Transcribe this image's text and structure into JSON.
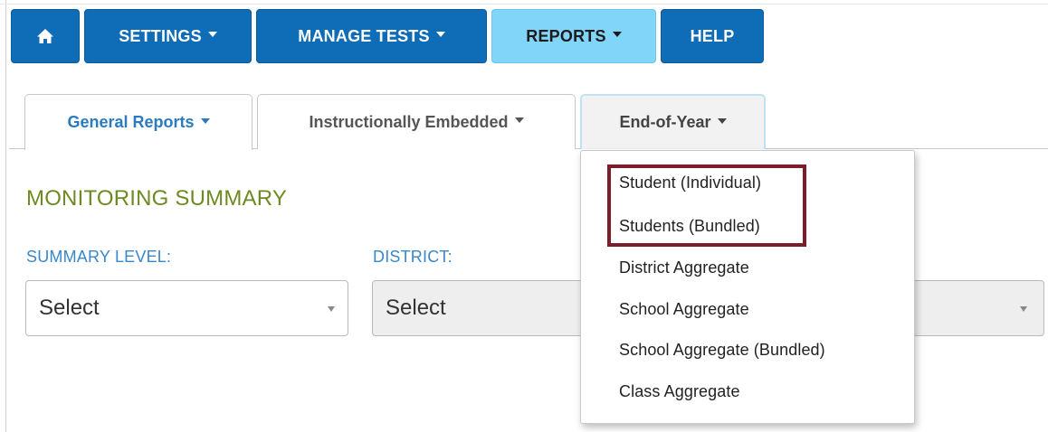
{
  "topnav": {
    "items": [
      {
        "id": "home",
        "label": "",
        "icon": "home-icon"
      },
      {
        "id": "settings",
        "label": "SETTINGS"
      },
      {
        "id": "manage_tests",
        "label": "MANAGE TESTS"
      },
      {
        "id": "reports",
        "label": "REPORTS",
        "active": true
      },
      {
        "id": "help",
        "label": "HELP"
      }
    ]
  },
  "tabs": [
    {
      "label": "General Reports",
      "active": true
    },
    {
      "label": "Instructionally Embedded"
    },
    {
      "label": "End-of-Year",
      "open": true
    }
  ],
  "main": {
    "title": "MONITORING SUMMARY",
    "summary_level": {
      "label": "SUMMARY LEVEL:",
      "value": "Select"
    },
    "district": {
      "label": "DISTRICT:",
      "value": "Select"
    }
  },
  "dropdown": {
    "items": [
      {
        "label": "Student (Individual)",
        "highlighted": true
      },
      {
        "label": "Students (Bundled)",
        "highlighted": true
      },
      {
        "label": "District Aggregate"
      },
      {
        "label": "School Aggregate"
      },
      {
        "label": "School Aggregate (Bundled)"
      },
      {
        "label": "Class Aggregate"
      }
    ]
  },
  "colors": {
    "nav_blue": "#0f6db7",
    "nav_active": "#81d5f8",
    "title_green": "#6e8a22",
    "label_blue": "#3a87c9",
    "highlight_red": "#7b1d2a"
  }
}
